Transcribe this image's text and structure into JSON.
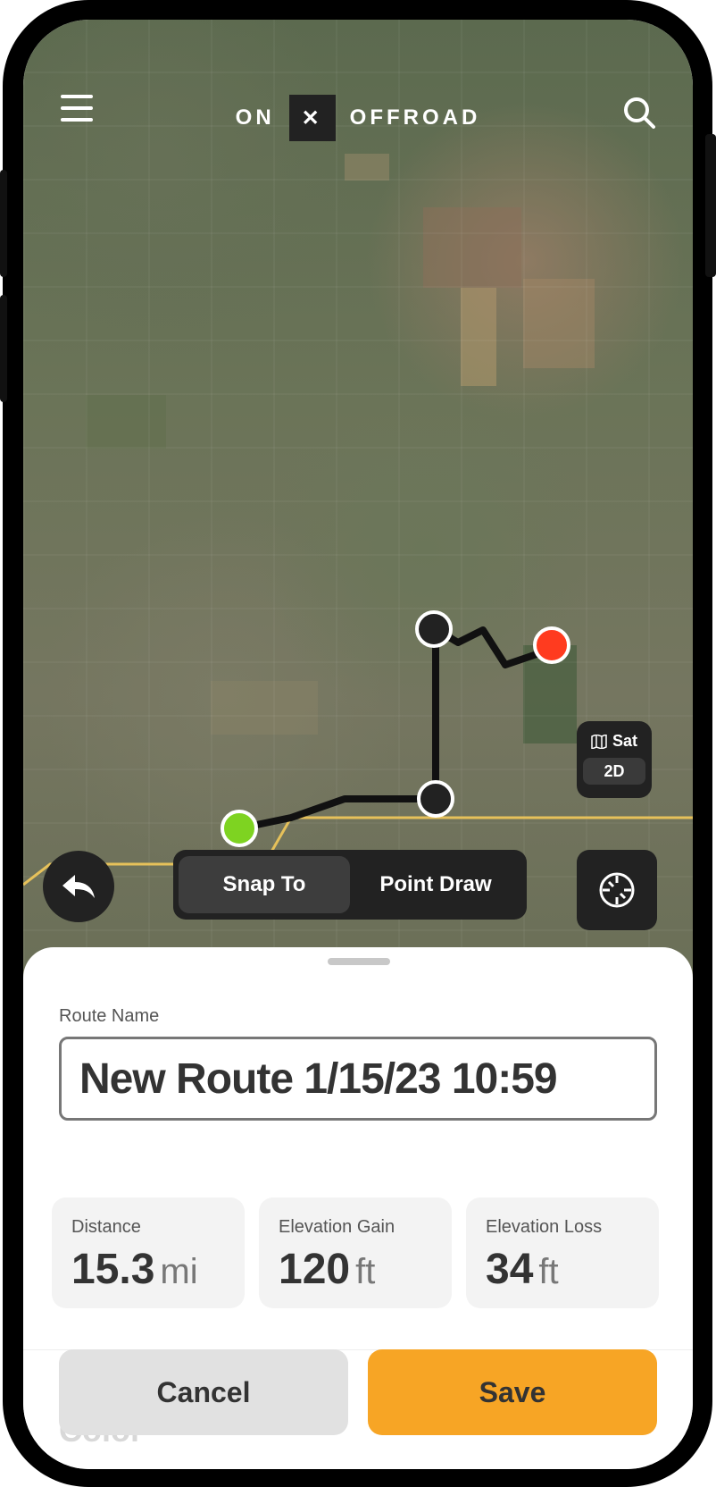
{
  "app": {
    "logo_left": "ON",
    "logo_mark": "✕",
    "logo_right": "OFFROAD"
  },
  "map": {
    "layer": {
      "icon": "map-icon",
      "type_label": "Sat",
      "view_label": "2D"
    }
  },
  "toolbar": {
    "modes": [
      {
        "label": "Snap To",
        "active": true
      },
      {
        "label": "Point Draw",
        "active": false
      }
    ]
  },
  "sheet": {
    "route_name_label": "Route Name",
    "route_name_value": "New Route 1/15/23 10:59",
    "stats": [
      {
        "label": "Distance",
        "value": "15.3",
        "unit": "mi"
      },
      {
        "label": "Elevation Gain",
        "value": "120",
        "unit": "ft"
      },
      {
        "label": "Elevation Loss",
        "value": "34",
        "unit": "ft"
      }
    ],
    "color_label": "Color",
    "cancel_label": "Cancel",
    "save_label": "Save"
  },
  "colors": {
    "accent": "#f7a525",
    "start_marker": "#7ed321",
    "end_marker": "#ff3b1f",
    "waypoint": "#222222"
  }
}
